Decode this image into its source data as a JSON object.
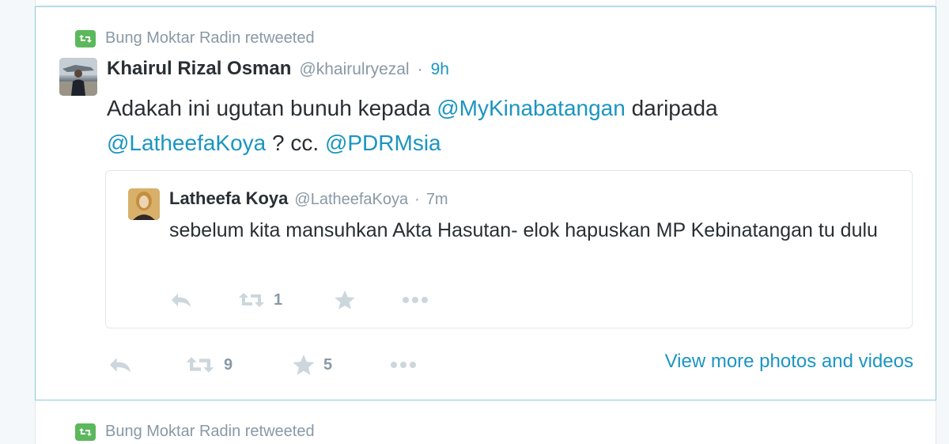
{
  "retweet_context": {
    "label": "Bung Moktar Radin retweeted"
  },
  "tweet": {
    "fullname": "Khairul Rizal Osman",
    "username": "@khairulryezal",
    "separator": "·",
    "time": "9h",
    "text_parts": [
      "Adakah ini ugutan bunuh kepada ",
      "@MyKinabatangan",
      " daripada",
      "@LatheefaKoya",
      " ? cc. ",
      "@PDRMsia"
    ],
    "retweet_count": "9",
    "favorite_count": "5",
    "view_more": "View more photos and videos"
  },
  "quoted_tweet": {
    "fullname": "Latheefa Koya",
    "username": "@LatheefaKoya",
    "separator": "·",
    "time": "7m",
    "text": "sebelum kita mansuhkan Akta Hasutan- elok hapuskan MP Kebinatangan tu dulu",
    "retweet_count": "1"
  },
  "next_retweet_context": {
    "label": "Bung Moktar Radin retweeted"
  },
  "icons": {
    "retweet_badge": "retweet-icon",
    "reply": "reply-icon",
    "retweet": "retweet-icon",
    "favorite": "star-icon",
    "more": "more-icon"
  },
  "colors": {
    "link": "#1b95c2",
    "retweet_badge": "#5cb85c",
    "muted": "#8899a6",
    "action_icon": "#ccd6dd",
    "card_border": "#8bc9dd"
  }
}
